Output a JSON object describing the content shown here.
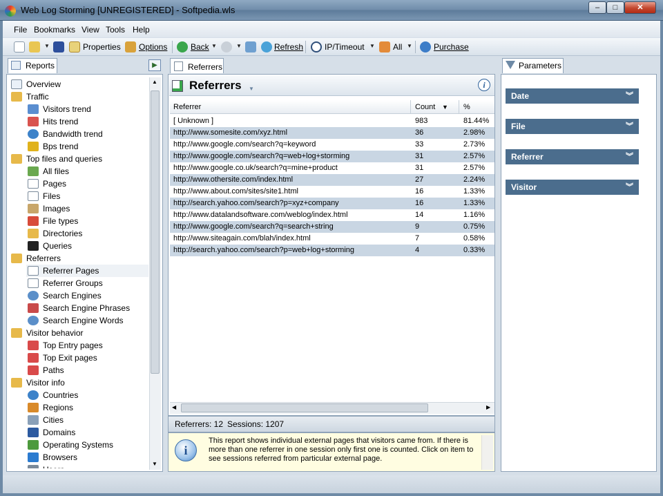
{
  "window": {
    "title": "Web Log Storming  [UNREGISTERED] - Softpedia.wls",
    "min": "–",
    "max": "□",
    "close": "✕"
  },
  "menu": [
    "File",
    "Bookmarks",
    "View",
    "Tools",
    "Help"
  ],
  "toolbar": {
    "properties": "Properties",
    "options": "Options",
    "back": "Back",
    "refresh": "Refresh",
    "ip_timeout": "IP/Timeout",
    "all": "All",
    "purchase": "Purchase"
  },
  "left": {
    "tab": "Reports",
    "items": [
      {
        "label": "Overview",
        "icon": "overview-icon",
        "level": 0
      },
      {
        "label": "Traffic",
        "icon": "folder-icon",
        "level": 0
      },
      {
        "label": "Visitors trend",
        "icon": "visitors-trend-icon",
        "level": 1
      },
      {
        "label": "Hits trend",
        "icon": "hits-trend-icon",
        "level": 1
      },
      {
        "label": "Bandwidth trend",
        "icon": "globe-icon",
        "level": 1
      },
      {
        "label": "Bps trend",
        "icon": "bps-icon",
        "level": 1
      },
      {
        "label": "Top files and queries",
        "icon": "folder-icon",
        "level": 0
      },
      {
        "label": "All files",
        "icon": "files-icon",
        "level": 1
      },
      {
        "label": "Pages",
        "icon": "page-icon",
        "level": 1
      },
      {
        "label": "Files",
        "icon": "file-icon",
        "level": 1
      },
      {
        "label": "Images",
        "icon": "image-icon",
        "level": 1
      },
      {
        "label": "File types",
        "icon": "file-types-icon",
        "level": 1
      },
      {
        "label": "Directories",
        "icon": "directory-icon",
        "level": 1
      },
      {
        "label": "Queries",
        "icon": "query-icon",
        "level": 1
      },
      {
        "label": "Referrers",
        "icon": "folder-icon",
        "level": 0
      },
      {
        "label": "Referrer Pages",
        "icon": "referrer-page-icon",
        "level": 1,
        "selected": true
      },
      {
        "label": "Referrer Groups",
        "icon": "referrer-group-icon",
        "level": 1
      },
      {
        "label": "Search Engines",
        "icon": "search-engine-icon",
        "level": 1
      },
      {
        "label": "Search Engine Phrases",
        "icon": "search-phrase-icon",
        "level": 1
      },
      {
        "label": "Search Engine Words",
        "icon": "search-word-icon",
        "level": 1
      },
      {
        "label": "Visitor behavior",
        "icon": "folder-icon",
        "level": 0
      },
      {
        "label": "Top Entry pages",
        "icon": "entry-icon",
        "level": 1
      },
      {
        "label": "Top Exit pages",
        "icon": "exit-icon",
        "level": 1
      },
      {
        "label": "Paths",
        "icon": "path-icon",
        "level": 1
      },
      {
        "label": "Visitor info",
        "icon": "folder-icon",
        "level": 0
      },
      {
        "label": "Countries",
        "icon": "globe-icon",
        "level": 1
      },
      {
        "label": "Regions",
        "icon": "region-icon",
        "level": 1
      },
      {
        "label": "Cities",
        "icon": "city-icon",
        "level": 1
      },
      {
        "label": "Domains",
        "icon": "domain-icon",
        "level": 1
      },
      {
        "label": "Operating Systems",
        "icon": "os-icon",
        "level": 1
      },
      {
        "label": "Browsers",
        "icon": "browser-icon",
        "level": 1
      },
      {
        "label": "Users",
        "icon": "users-icon",
        "level": 1
      }
    ]
  },
  "center": {
    "tab": "Referrers",
    "heading": "Referrers",
    "columns": [
      "Referrer",
      "Count",
      "%"
    ],
    "rows": [
      [
        "[ Unknown ]",
        "983",
        "81.44%"
      ],
      [
        "http://www.somesite.com/xyz.html",
        "36",
        "2.98%"
      ],
      [
        "http://www.google.com/search?q=keyword",
        "33",
        "2.73%"
      ],
      [
        "http://www.google.com/search?q=web+log+storming",
        "31",
        "2.57%"
      ],
      [
        "http://www.google.co.uk/search?q=mine+product",
        "31",
        "2.57%"
      ],
      [
        "http://www.othersite.com/index.html",
        "27",
        "2.24%"
      ],
      [
        "http://www.about.com/sites/site1.html",
        "16",
        "1.33%"
      ],
      [
        "http://search.yahoo.com/search?p=xyz+company",
        "16",
        "1.33%"
      ],
      [
        "http://www.datalandsoftware.com/weblog/index.html",
        "14",
        "1.16%"
      ],
      [
        "http://www.google.com/search?q=search+string",
        "9",
        "0.75%"
      ],
      [
        "http://www.siteagain.com/blah/index.html",
        "7",
        "0.58%"
      ],
      [
        "http://search.yahoo.com/search?p=web+log+storming",
        "4",
        "0.33%"
      ]
    ],
    "status": {
      "referrers": "Referrers: 12",
      "sessions": "Sessions: 1207"
    },
    "info": "This report shows individual external pages that visitors came from. If there is more than one referrer in one session only first one is counted. Click on item to see sessions referred from particular external page."
  },
  "right": {
    "tab": "Parameters",
    "params": [
      "Date",
      "File",
      "Referrer",
      "Visitor"
    ]
  },
  "colors": {
    "accent": "#4b6d8d",
    "alt_row": "#c9d6e3",
    "info_bg": "#fffde1"
  }
}
